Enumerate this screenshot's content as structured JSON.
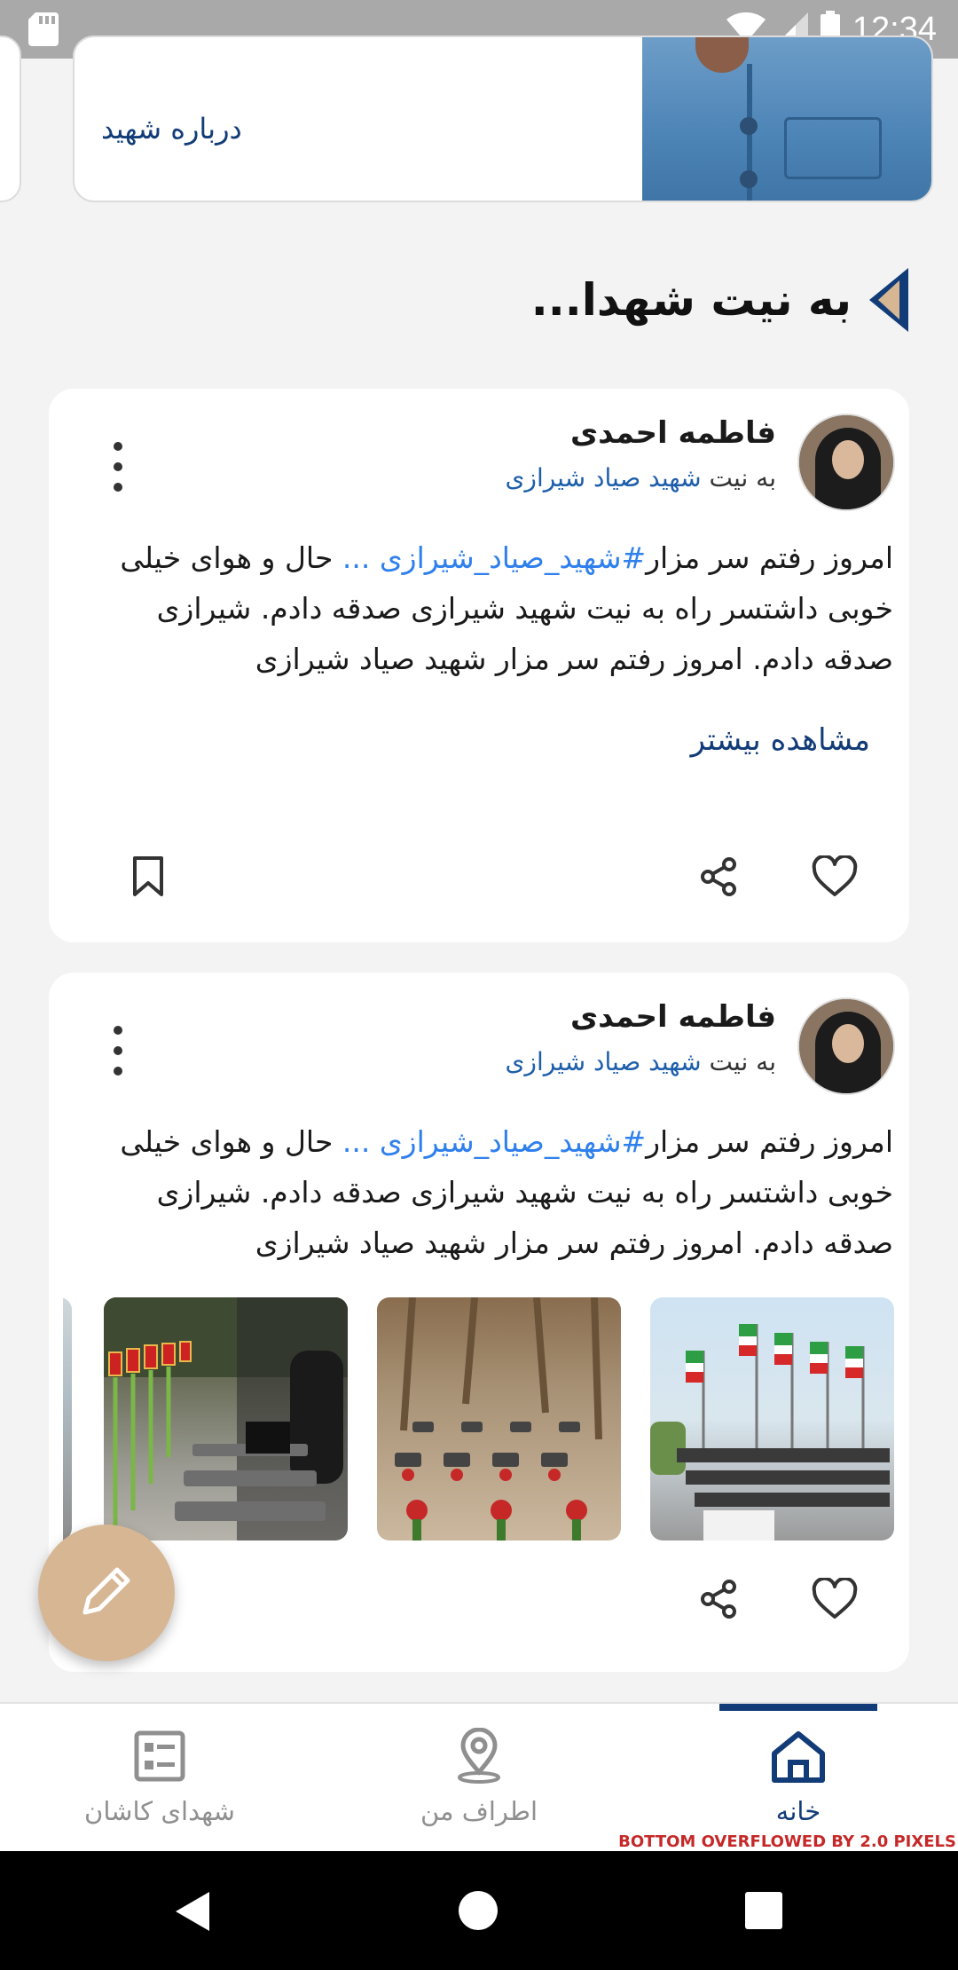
{
  "status_bar": {
    "time": "12:34"
  },
  "top_card": {
    "about_label": "درباره شهید"
  },
  "section": {
    "title": "به نیت شهدا..."
  },
  "posts": [
    {
      "author": "فاطمه احمدی",
      "subtitle_prefix": "به نیت",
      "subtitle_link": "شهید صیاد شیرازی",
      "line1_start": "امروز رفتم سر مزار",
      "hashtag": "#شهید_صیاد_شیرازی ...",
      "line1_end": "حال و هوای خیلی",
      "line2": "خوبی داشتسر راه به نیت شهید شیرازی صدقه دادم. شیرازی",
      "line3": "صدقه دادم. امروز رفتم سر مزار شهید صیاد شیرازی",
      "more_label": "مشاهده بیشتر"
    },
    {
      "author": "فاطمه احمدی",
      "subtitle_prefix": "به نیت",
      "subtitle_link": "شهید صیاد شیرازی",
      "line1_start": "امروز رفتم سر مزار",
      "hashtag": "#شهید_صیاد_شیرازی ...",
      "line1_end": "حال و هوای خیلی",
      "line2": "خوبی داشتسر راه به نیت شهید شیرازی صدقه دادم. شیرازی",
      "line3": "صدقه دادم. امروز رفتم سر مزار شهید صیاد شیرازی"
    }
  ],
  "bottom_nav": {
    "items": [
      {
        "label": "شهدای کاشان",
        "icon": "list-icon"
      },
      {
        "label": "اطراف من",
        "icon": "location-pin-icon"
      },
      {
        "label": "خانه",
        "icon": "home-icon",
        "active": true
      }
    ],
    "overflow_text": "BOTTOM OVERFLOWED BY 2.0 PIXELS"
  },
  "colors": {
    "brand": "#123c78",
    "link": "#1d5eab",
    "hashtag": "#2f80ed",
    "fab": "#d7b694",
    "error": "#c62828"
  }
}
